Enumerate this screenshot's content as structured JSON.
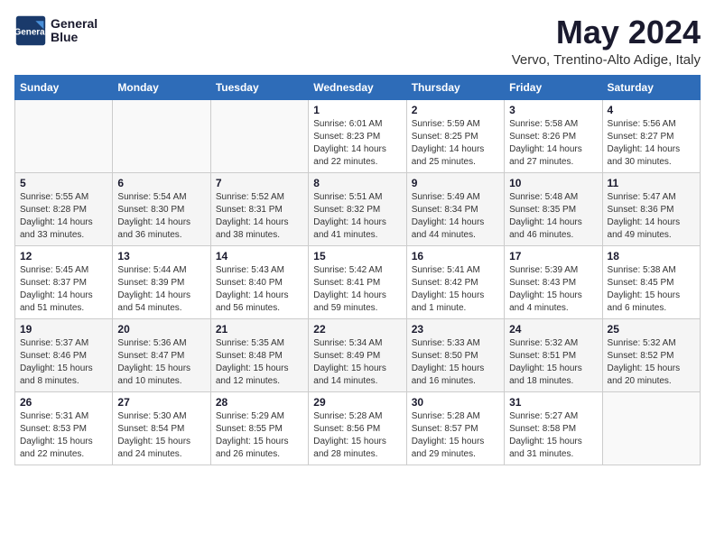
{
  "header": {
    "logo_line1": "General",
    "logo_line2": "Blue",
    "month_title": "May 2024",
    "location": "Vervo, Trentino-Alto Adige, Italy"
  },
  "weekdays": [
    "Sunday",
    "Monday",
    "Tuesday",
    "Wednesday",
    "Thursday",
    "Friday",
    "Saturday"
  ],
  "weeks": [
    [
      {
        "day": "",
        "info": ""
      },
      {
        "day": "",
        "info": ""
      },
      {
        "day": "",
        "info": ""
      },
      {
        "day": "1",
        "info": "Sunrise: 6:01 AM\nSunset: 8:23 PM\nDaylight: 14 hours\nand 22 minutes."
      },
      {
        "day": "2",
        "info": "Sunrise: 5:59 AM\nSunset: 8:25 PM\nDaylight: 14 hours\nand 25 minutes."
      },
      {
        "day": "3",
        "info": "Sunrise: 5:58 AM\nSunset: 8:26 PM\nDaylight: 14 hours\nand 27 minutes."
      },
      {
        "day": "4",
        "info": "Sunrise: 5:56 AM\nSunset: 8:27 PM\nDaylight: 14 hours\nand 30 minutes."
      }
    ],
    [
      {
        "day": "5",
        "info": "Sunrise: 5:55 AM\nSunset: 8:28 PM\nDaylight: 14 hours\nand 33 minutes."
      },
      {
        "day": "6",
        "info": "Sunrise: 5:54 AM\nSunset: 8:30 PM\nDaylight: 14 hours\nand 36 minutes."
      },
      {
        "day": "7",
        "info": "Sunrise: 5:52 AM\nSunset: 8:31 PM\nDaylight: 14 hours\nand 38 minutes."
      },
      {
        "day": "8",
        "info": "Sunrise: 5:51 AM\nSunset: 8:32 PM\nDaylight: 14 hours\nand 41 minutes."
      },
      {
        "day": "9",
        "info": "Sunrise: 5:49 AM\nSunset: 8:34 PM\nDaylight: 14 hours\nand 44 minutes."
      },
      {
        "day": "10",
        "info": "Sunrise: 5:48 AM\nSunset: 8:35 PM\nDaylight: 14 hours\nand 46 minutes."
      },
      {
        "day": "11",
        "info": "Sunrise: 5:47 AM\nSunset: 8:36 PM\nDaylight: 14 hours\nand 49 minutes."
      }
    ],
    [
      {
        "day": "12",
        "info": "Sunrise: 5:45 AM\nSunset: 8:37 PM\nDaylight: 14 hours\nand 51 minutes."
      },
      {
        "day": "13",
        "info": "Sunrise: 5:44 AM\nSunset: 8:39 PM\nDaylight: 14 hours\nand 54 minutes."
      },
      {
        "day": "14",
        "info": "Sunrise: 5:43 AM\nSunset: 8:40 PM\nDaylight: 14 hours\nand 56 minutes."
      },
      {
        "day": "15",
        "info": "Sunrise: 5:42 AM\nSunset: 8:41 PM\nDaylight: 14 hours\nand 59 minutes."
      },
      {
        "day": "16",
        "info": "Sunrise: 5:41 AM\nSunset: 8:42 PM\nDaylight: 15 hours\nand 1 minute."
      },
      {
        "day": "17",
        "info": "Sunrise: 5:39 AM\nSunset: 8:43 PM\nDaylight: 15 hours\nand 4 minutes."
      },
      {
        "day": "18",
        "info": "Sunrise: 5:38 AM\nSunset: 8:45 PM\nDaylight: 15 hours\nand 6 minutes."
      }
    ],
    [
      {
        "day": "19",
        "info": "Sunrise: 5:37 AM\nSunset: 8:46 PM\nDaylight: 15 hours\nand 8 minutes."
      },
      {
        "day": "20",
        "info": "Sunrise: 5:36 AM\nSunset: 8:47 PM\nDaylight: 15 hours\nand 10 minutes."
      },
      {
        "day": "21",
        "info": "Sunrise: 5:35 AM\nSunset: 8:48 PM\nDaylight: 15 hours\nand 12 minutes."
      },
      {
        "day": "22",
        "info": "Sunrise: 5:34 AM\nSunset: 8:49 PM\nDaylight: 15 hours\nand 14 minutes."
      },
      {
        "day": "23",
        "info": "Sunrise: 5:33 AM\nSunset: 8:50 PM\nDaylight: 15 hours\nand 16 minutes."
      },
      {
        "day": "24",
        "info": "Sunrise: 5:32 AM\nSunset: 8:51 PM\nDaylight: 15 hours\nand 18 minutes."
      },
      {
        "day": "25",
        "info": "Sunrise: 5:32 AM\nSunset: 8:52 PM\nDaylight: 15 hours\nand 20 minutes."
      }
    ],
    [
      {
        "day": "26",
        "info": "Sunrise: 5:31 AM\nSunset: 8:53 PM\nDaylight: 15 hours\nand 22 minutes."
      },
      {
        "day": "27",
        "info": "Sunrise: 5:30 AM\nSunset: 8:54 PM\nDaylight: 15 hours\nand 24 minutes."
      },
      {
        "day": "28",
        "info": "Sunrise: 5:29 AM\nSunset: 8:55 PM\nDaylight: 15 hours\nand 26 minutes."
      },
      {
        "day": "29",
        "info": "Sunrise: 5:28 AM\nSunset: 8:56 PM\nDaylight: 15 hours\nand 28 minutes."
      },
      {
        "day": "30",
        "info": "Sunrise: 5:28 AM\nSunset: 8:57 PM\nDaylight: 15 hours\nand 29 minutes."
      },
      {
        "day": "31",
        "info": "Sunrise: 5:27 AM\nSunset: 8:58 PM\nDaylight: 15 hours\nand 31 minutes."
      },
      {
        "day": "",
        "info": ""
      }
    ]
  ]
}
